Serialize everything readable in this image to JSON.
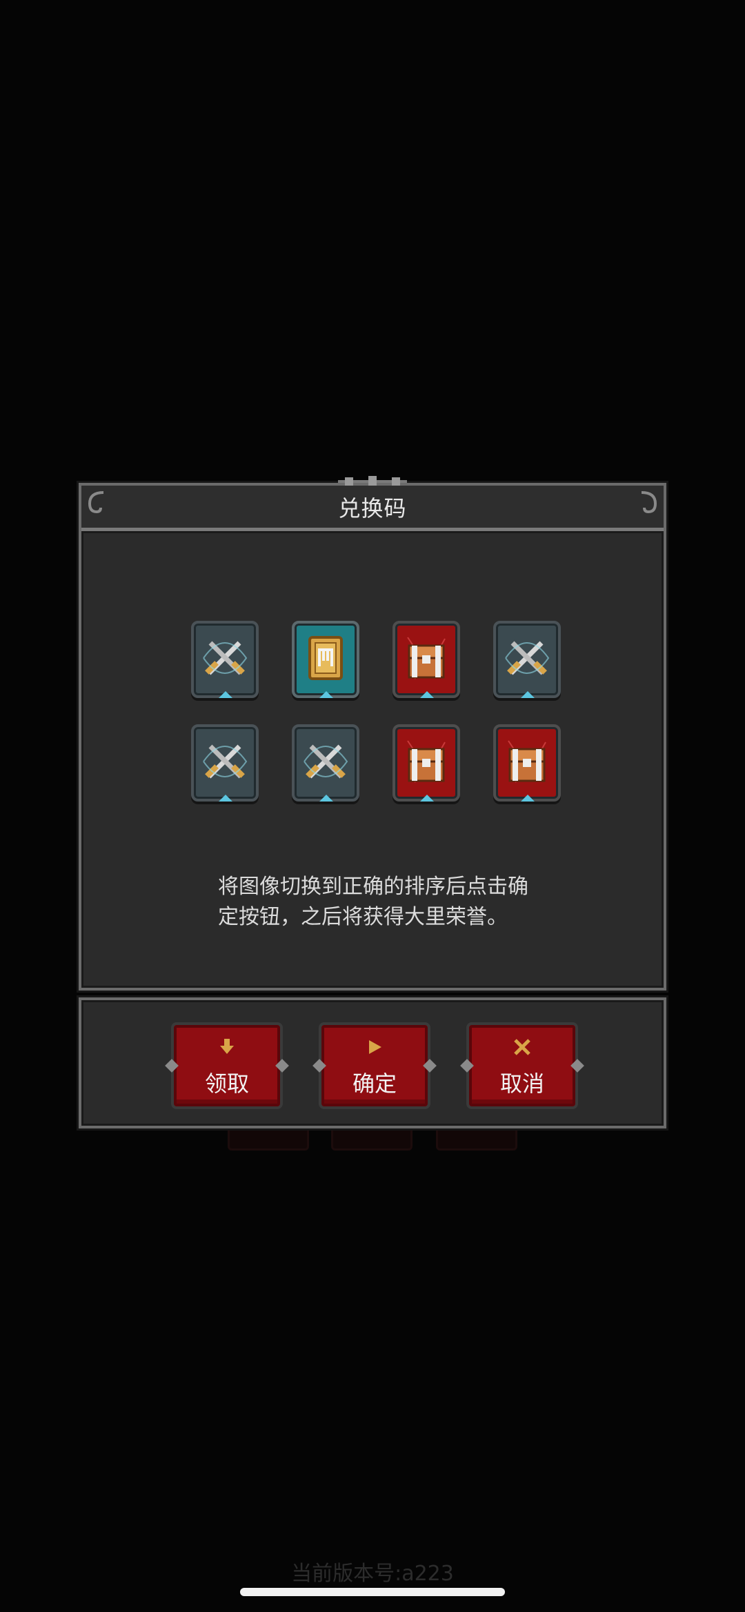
{
  "dialog": {
    "title": "兑换码",
    "instruction_line1": "将图像切换到正确的排序后点击确",
    "instruction_line2": "定按钮，之后将获得大里荣誉。"
  },
  "tiles": [
    {
      "type": "blade",
      "icon": "crossed-swords-icon"
    },
    {
      "type": "card",
      "icon": "rune-card-icon"
    },
    {
      "type": "chest",
      "icon": "treasure-chest-icon"
    },
    {
      "type": "blade",
      "icon": "crossed-swords-icon"
    },
    {
      "type": "blade",
      "icon": "crossed-swords-icon"
    },
    {
      "type": "blade",
      "icon": "crossed-swords-icon"
    },
    {
      "type": "chest",
      "icon": "treasure-chest-icon"
    },
    {
      "type": "chest",
      "icon": "treasure-chest-icon"
    }
  ],
  "actions": {
    "claim": {
      "label": "领取",
      "icon": "down-arrow-icon"
    },
    "confirm": {
      "label": "确定",
      "icon": "play-icon"
    },
    "cancel": {
      "label": "取消",
      "icon": "close-x-icon"
    }
  },
  "footer": {
    "version": "当前版本号:a223"
  },
  "colors": {
    "panel_bg": "#2b2b2b",
    "panel_border": "#6b6b6b",
    "button_red": "#8f0d12",
    "icon_gold": "#d9a548"
  }
}
